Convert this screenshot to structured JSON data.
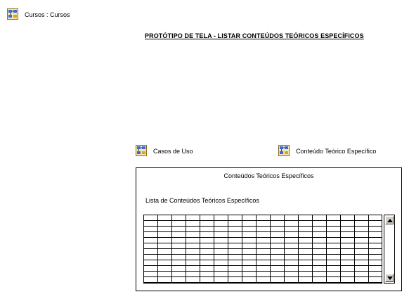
{
  "header": {
    "link_label": "Cursos : Cursos"
  },
  "page_title": "PROTÓTIPO DE TELA - LISTAR CONTEÚDOS TEÓRICOS ESPECÍFICOS",
  "links": [
    {
      "label": "Casos de Uso"
    },
    {
      "label": "Conteúdo Teórico Específico"
    }
  ],
  "form": {
    "title": "Conteúdos Teóricos Específicos",
    "list_label": "Lista de Conteúdos Teóricos Específicos"
  },
  "icons": {
    "diagram_link": "diagram-icon",
    "scroll_up": "arrow-up-icon",
    "scroll_down": "arrow-down-icon"
  }
}
